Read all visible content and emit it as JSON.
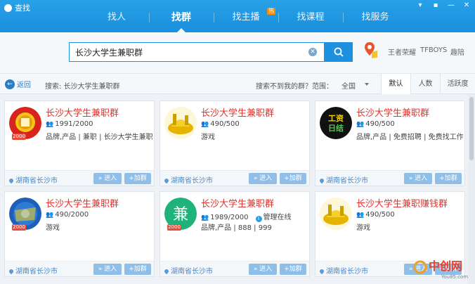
{
  "window": {
    "title": "查找"
  },
  "nav": {
    "tabs": [
      {
        "label": "找人"
      },
      {
        "label": "找群"
      },
      {
        "label": "找主播",
        "badge": "热"
      },
      {
        "label": "找课程"
      },
      {
        "label": "找服务"
      }
    ],
    "active_tab": "找群"
  },
  "search": {
    "value": "长沙大学生兼职群",
    "quick_tags": [
      "王者荣耀",
      "TFBOYS",
      "趣陪"
    ]
  },
  "filter_bar": {
    "back_label": "返回",
    "search_desc": "搜索: 长沙大学生兼职群",
    "not_found": "搜索不到我的群？",
    "scope_label": "范围：",
    "scope_value": "全国",
    "sort_tabs": [
      "默认",
      "人数",
      "活跃度"
    ],
    "active_sort": "默认"
  },
  "buttons": {
    "enter": "» 进入",
    "join": "+加群"
  },
  "groups": [
    {
      "name": "长沙大学生兼职群",
      "members": "1991/2000",
      "tags": "品牌,产品 | 兼职 | 长沙大学生兼职群",
      "location": "湖南省长沙市",
      "level": "2000",
      "avatar": "red-gold"
    },
    {
      "name": "长沙大学生兼职群",
      "members": "490/500",
      "tags": "游戏",
      "location": "湖南省长沙市",
      "avatar": "gold-ingot"
    },
    {
      "name": "长沙大学生兼职群",
      "members": "490/500",
      "tags": "品牌,产品 | 免费招聘 | 免费找工作...",
      "location": "湖南省长沙市",
      "avatar": "black-text",
      "avatar_text": [
        "工资",
        "日结"
      ]
    },
    {
      "name": "长沙大学生兼职群",
      "members": "490/2000",
      "tags": "游戏",
      "location": "湖南省长沙市",
      "level": "2000",
      "avatar": "blue-text"
    },
    {
      "name": "长沙大学生兼职群",
      "members": "1989/2000",
      "managed": "管理在线",
      "tags": "品牌,产品 | 888 | 999",
      "location": "湖南省长沙市",
      "level": "2000",
      "avatar": "green-char",
      "avatar_text": [
        "兼"
      ]
    },
    {
      "name": "长沙大学生兼职赚钱群",
      "members": "490/500",
      "tags": "游戏",
      "location": "湖南省长沙市",
      "avatar": "gold-ingot"
    }
  ],
  "watermark": {
    "text": "中创网",
    "sub": "You85.com"
  }
}
